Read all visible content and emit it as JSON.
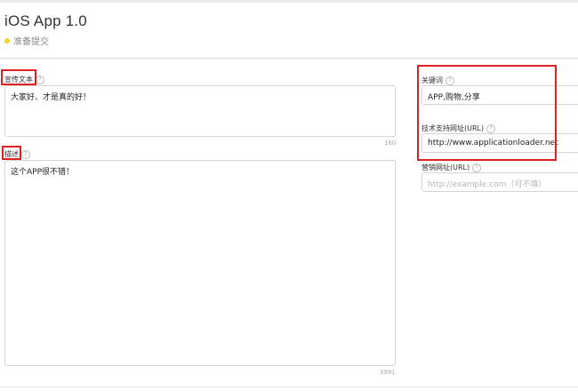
{
  "app": {
    "title": "iOS App 1.0",
    "status": "准备提交",
    "status_color": "#f3d31f"
  },
  "promo": {
    "label": "宣传文本",
    "value": "大家好、才是真的好！",
    "counter": "160"
  },
  "description": {
    "label": "描述",
    "value": "这个APP很不错！",
    "counter": "3991"
  },
  "keywords": {
    "label": "关键词",
    "value": "APP,购物,分享"
  },
  "support_url": {
    "label": "技术支持网址(URL)",
    "value": "http://www.applicationloader.net"
  },
  "marketing_url": {
    "label": "营销网址(URL)",
    "placeholder": "http://example.com（可不填）"
  },
  "help_glyph": "?",
  "highlight_color": "#e02020"
}
